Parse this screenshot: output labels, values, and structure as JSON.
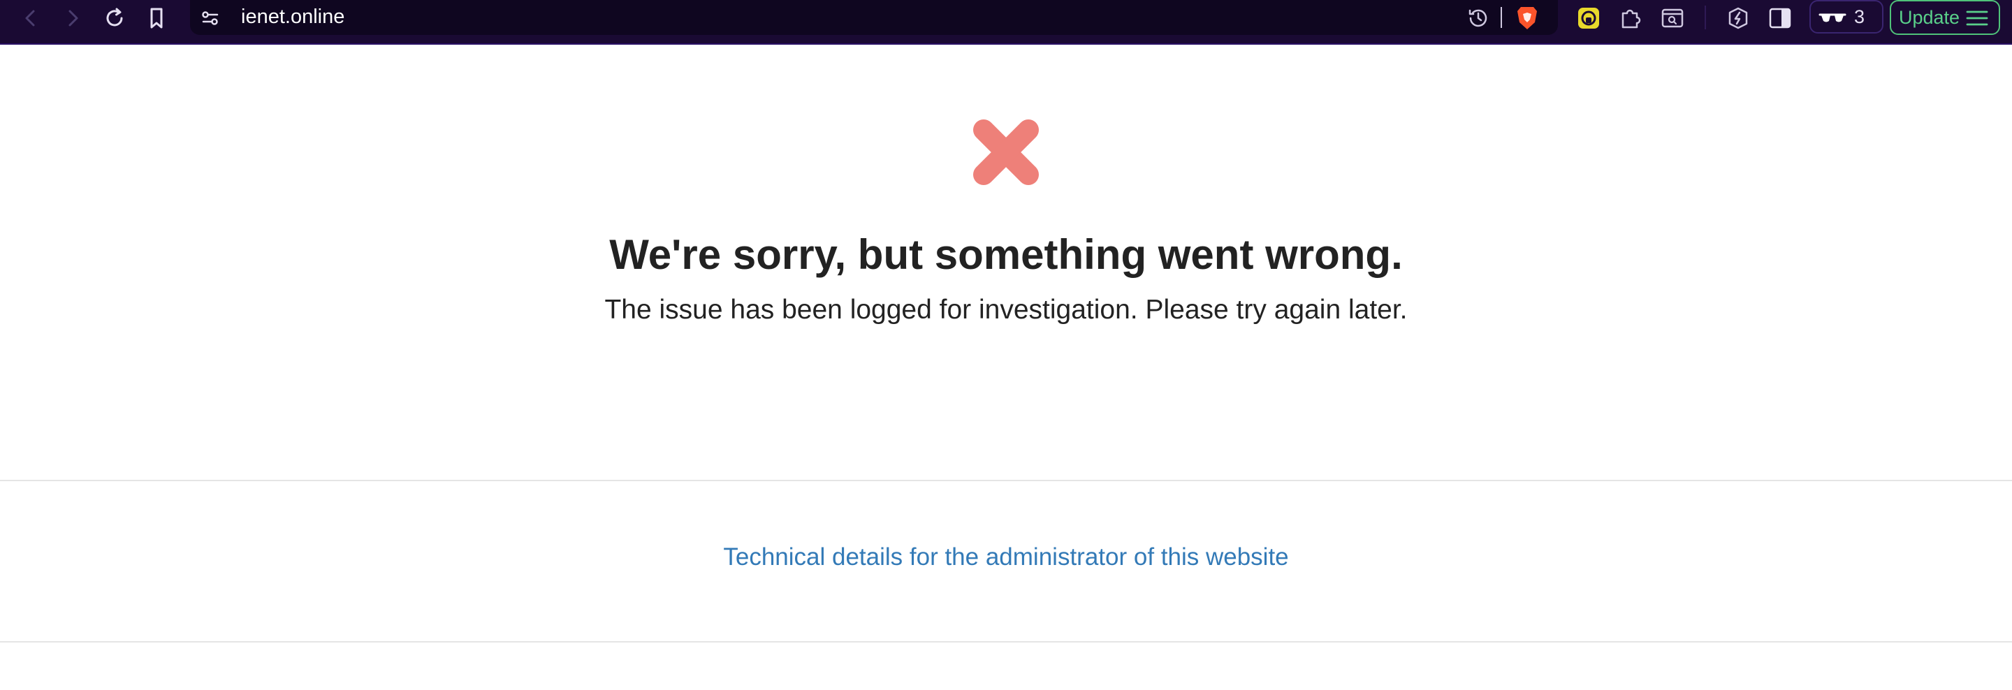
{
  "browser": {
    "url": "ienet.online",
    "vpn_count": "3",
    "update_label": "Update",
    "icons": [
      "back-icon",
      "forward-icon",
      "reload-icon",
      "bookmark-icon",
      "site-settings-icon",
      "history-icon",
      "brave-shields-icon",
      "extension-icon",
      "puzzle-extensions-icon",
      "screenshot-search-icon",
      "leo-ai-icon",
      "sidebar-toggle-icon",
      "private-vpn-icon",
      "menu-icon"
    ],
    "colors": {
      "toolbar_bg": "#1a0a33",
      "update_accent": "#5ad08a",
      "shield": "#fb542b"
    }
  },
  "page": {
    "title": "We're sorry, but something went wrong.",
    "message": "The issue has been logged for investigation. Please try again later.",
    "tech_link": "Technical details for the administrator of this website",
    "icon": "error-x-icon",
    "colors": {
      "error_icon": "#ee8079",
      "link": "#337ab7",
      "text": "#222222"
    }
  }
}
